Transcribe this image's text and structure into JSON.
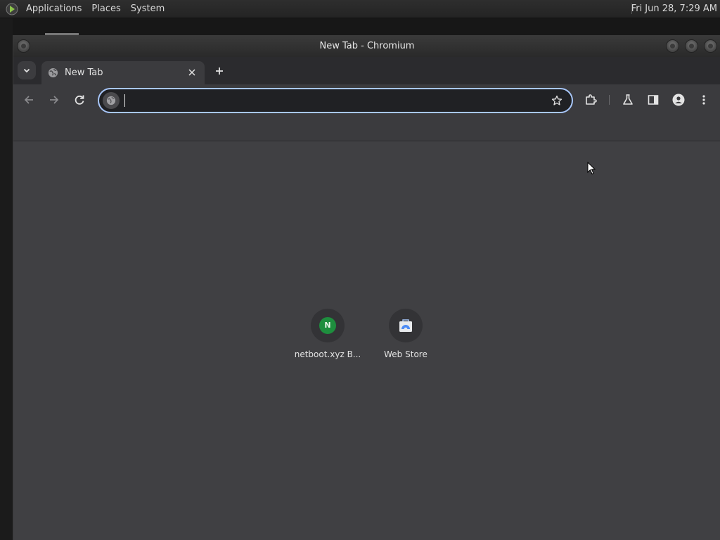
{
  "panel": {
    "menus": [
      "Applications",
      "Places",
      "System"
    ],
    "clock": "Fri Jun 28,  7:29 AM"
  },
  "window": {
    "title": "New Tab - Chromium"
  },
  "tabs": [
    {
      "title": "New Tab",
      "icon": "globe-icon",
      "active": true
    }
  ],
  "omnibox": {
    "value": "",
    "placeholder": ""
  },
  "shortcuts": [
    {
      "label": "netboot.xyz B...",
      "icon_letter": "N",
      "icon_color": "#1e8e3e"
    },
    {
      "label": "Web Store",
      "icon": "web-store-icon",
      "icon_color": "#4c8bf5"
    }
  ],
  "colors": {
    "accent": "#a8c7fa",
    "toolbar": "#3b3b3e",
    "content_bg": "#404043",
    "tabstrip": "#2b2b2e"
  }
}
